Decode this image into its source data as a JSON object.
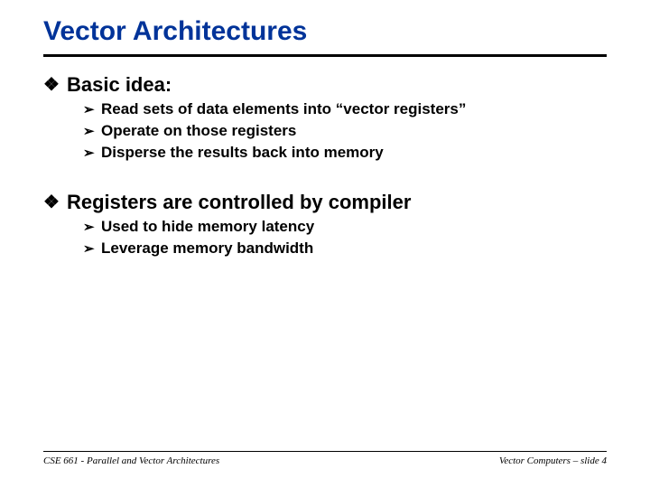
{
  "title": "Vector Architectures",
  "section1": {
    "heading": "Basic idea:",
    "items": [
      "Read sets of data elements into “vector registers”",
      "Operate on those registers",
      "Disperse the results back into memory"
    ]
  },
  "section2": {
    "heading": "Registers are controlled by compiler",
    "items": [
      "Used to hide memory latency",
      "Leverage memory bandwidth"
    ]
  },
  "footer": {
    "left": "CSE 661 - Parallel and Vector Architectures",
    "right": "Vector Computers – slide 4"
  },
  "bullets": {
    "lvl1": "❖",
    "lvl2": "➢"
  }
}
